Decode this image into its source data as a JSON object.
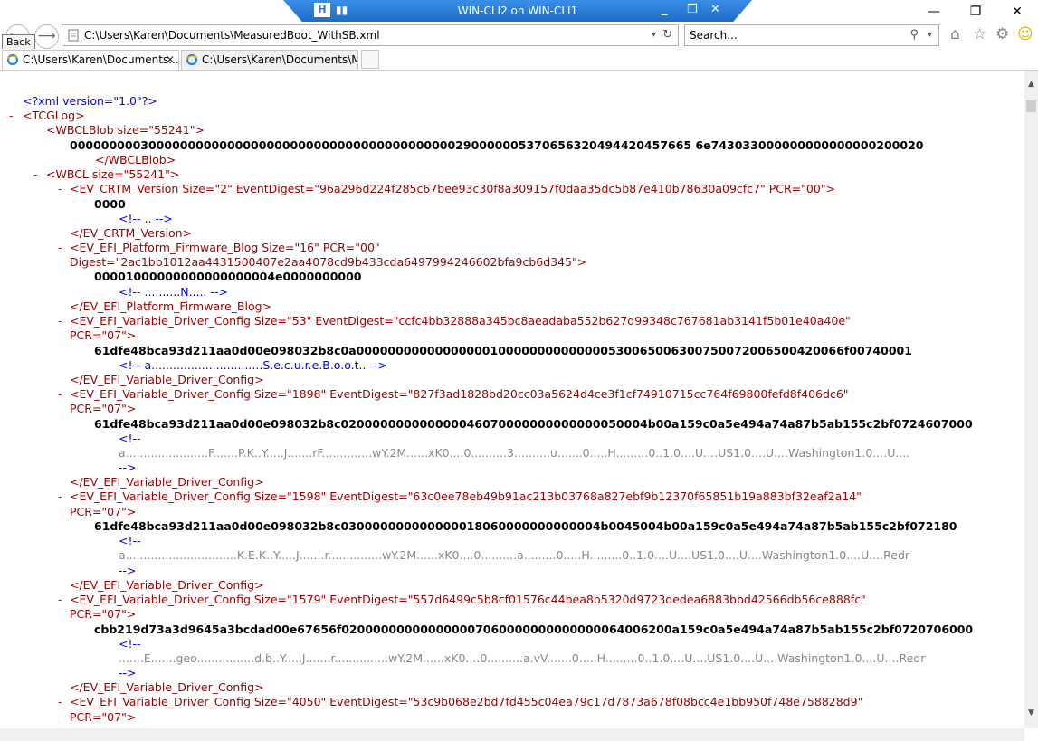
{
  "remote": {
    "title": "WIN-CLI2 on WIN-CLI1"
  },
  "window": {
    "minimize": "—",
    "restore": "❐",
    "close": "✕"
  },
  "nav": {
    "back_tooltip": "Back",
    "back": "⟵",
    "forward": "⟶"
  },
  "address": {
    "url": "C:\\Users\\Karen\\Documents\\MeasuredBoot_WithSB.xml",
    "dropdown": "▾",
    "refresh": "↻"
  },
  "search": {
    "placeholder": "Search...",
    "icon": "⚲",
    "dropdown": "▾"
  },
  "tabs": [
    {
      "label": "C:\\Users\\Karen\\Documents...",
      "close": "✕"
    },
    {
      "label": "C:\\Users\\Karen\\Documents\\M..."
    }
  ],
  "xml": {
    "decl": "<?xml version=\"1.0\"?>",
    "l_tcglog": "<TCGLog>",
    "l_blob_open": "<WBCLBlob size=\"55241\">",
    "l_blob_text": "0000000003000000000000000000000000000000000000000290000005370656320494420457665 6e743033000000000000000200020",
    "l_blob_close": "</WBCLBlob>",
    "l_wbcl_open": "<WBCL size=\"55241\">",
    "crtm_open": "<EV_CRTM_Version Size=\"2\" EventDigest=\"96a296d224f285c67bee93c30f8a309157f0daa35dc5b87e410b78630a09cfc7\" PCR=\"00\">",
    "crtm_val": "0000",
    "crtm_cmt": "<!-- .. -->",
    "crtm_close": "</EV_CRTM_Version>",
    "blog_open1": "<EV_EFI_Platform_Firmware_Blog Size=\"16\" PCR=\"00\"",
    "blog_open2": "Digest=\"2ac1bb1012aa4431500407e2aa4078cd9b433cda6497994246602bfa9cb6d345\">",
    "blog_val": "00001000000000000000004e0000000000",
    "blog_cmt": "<!-- ..........N..... -->",
    "blog_close": "</EV_EFI_Platform_Firmware_Blog>",
    "v1_open": "<EV_EFI_Variable_Driver_Config Size=\"53\" EventDigest=\"ccfc4bb32888a345bc8aeadaba552b627d99348c767681ab3141f5b01e40a40e\"",
    "v1_pcr": "PCR=\"07\">",
    "v1_val": "61dfe48bca93d211aa0d00e098032b8c0a00000000000000000100000000000000530065006300750072006500420066f00740001",
    "v1_cmt": "<!-- a...............................S.e.c.u.r.e.B.o.o.t.. -->",
    "v1_close": "</EV_EFI_Variable_Driver_Config>",
    "v2_open": "<EV_EFI_Variable_Driver_Config Size=\"1898\" EventDigest=\"827f3ad1828bd20cc03a5624d4ce3f1cf74910715cc764f69800fefd8f406dc6\"",
    "v2_pcr": "PCR=\"07\">",
    "v2_val": "61dfe48bca93d211aa0d00e098032b8c020000000000000046070000000000000050004b00a159c0a5e494a74a87b5ab155c2bf0724607000",
    "v2_cmt_open": "<!--",
    "v2_cmt": "a.......................F.......P.K..Y.....J.......rF..............wY.2M......xK0....0..........3..........u.......0.....H.........0..1.0....U....US1.0....U....Washington1.0....U....",
    "v2_cmt_close": "-->",
    "v2_close": "</EV_EFI_Variable_Driver_Config>",
    "v3_open": "<EV_EFI_Variable_Driver_Config Size=\"1598\" EventDigest=\"63c0ee78eb49b91ac213b03768a827ebf9b12370f65851b19a883bf32eaf2a14\"",
    "v3_pcr": "PCR=\"07\">",
    "v3_val": "61dfe48bca93d211aa0d00e098032b8c030000000000000018060000000000004b0045004b00a159c0a5e494a74a87b5ab155c2bf072180",
    "v3_cmt_open": "<!--",
    "v3_cmt": "a...............................K.E.K..Y.....J.......r...............wY.2M......xK0....0..........a.........0.....H.........0..1.0....U....US1.0....U....Washington1.0....U....Redr",
    "v3_cmt_close": "-->",
    "v3_close": "</EV_EFI_Variable_Driver_Config>",
    "v4_open": "<EV_EFI_Variable_Driver_Config Size=\"1579\" EventDigest=\"557d6499c5b8cf01576c44bea8b5320d9723dedea6883bbd42566db56ce888fc\"",
    "v4_pcr": "PCR=\"07\">",
    "v4_val": "cbb219d73a3d9645a3bcdad00e67656f020000000000000007060000000000000064006200a159c0a5e494a74a87b5ab155c2bf0720706000",
    "v4_cmt_open": "<!--",
    "v4_cmt": ".......E.......geo................d.b..Y.....J.......r...............wY.2M......xK0....0..........a.vV.......0.....H.........0..1.0....U....US1.0....U....Washington1.0....U....Redr",
    "v4_cmt_close": "-->",
    "v4_close": "</EV_EFI_Variable_Driver_Config>",
    "v5_open": "<EV_EFI_Variable_Driver_Config Size=\"4050\" EventDigest=\"53c9b068e2bd7fd455c04ea79c17d7873a678f08bcc4e1bb950f748e758828d9\"",
    "v5_pcr": "PCR=\"07\">",
    "minus": "-"
  }
}
